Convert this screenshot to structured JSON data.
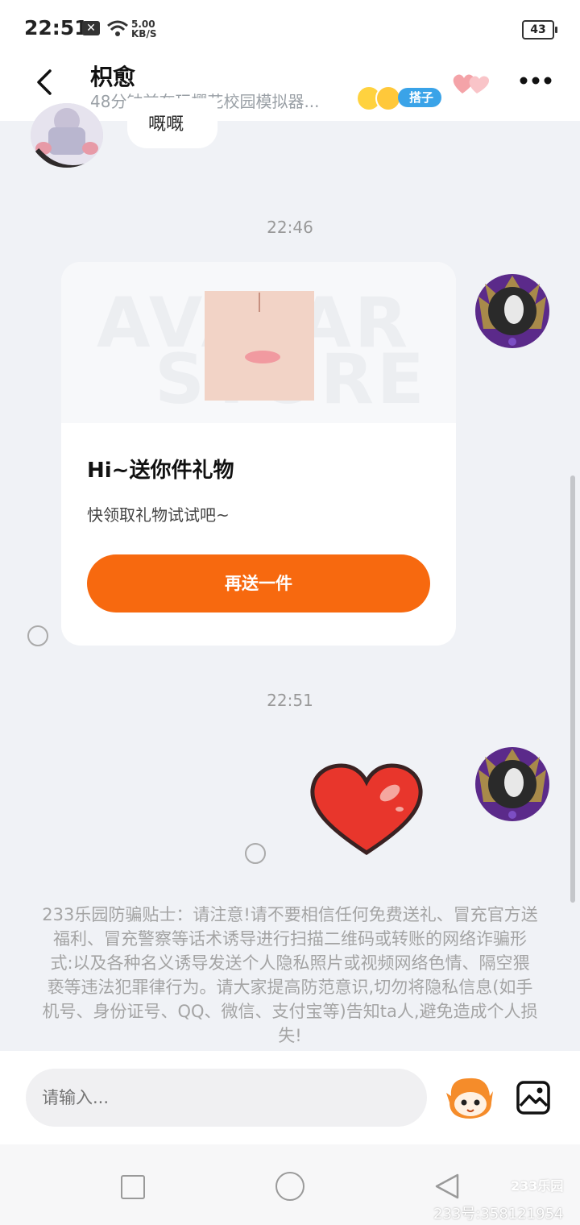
{
  "status_bar": {
    "time": "22:51",
    "notification_badge": "✕",
    "net_speed_value": "5.00",
    "net_speed_unit": "KB/S",
    "battery": "43"
  },
  "header": {
    "contact_name": "枳愈",
    "contact_status": "48分钟前在玩樱花校园模拟器...",
    "relation_badge": "搭子",
    "icons": [
      "back-arrow-icon",
      "hearts-icon",
      "more-icon"
    ]
  },
  "chat": {
    "partial_bubble_text": "嘅嘅",
    "timestamps": [
      "22:46",
      "22:51"
    ],
    "gift_card": {
      "watermark_line1": "AVATAR",
      "watermark_line2": "STORE",
      "title": "Hi~送你件礼物",
      "subtitle": "快领取礼物试试吧~",
      "button_label": "再送一件"
    }
  },
  "notice": {
    "text": "233乐园防骗贴士：请注意!请不要相信任何免费送礼、冒充官方送福利、冒充警察等话术诱导进行扫描二维码或转账的网络诈骗形式:以及各种名义诱导发送个人隐私照片或视频网络色情、隔空猥亵等违法犯罪律行为。请大家提高防范意识,切勿将隐私信息(如手机号、身份证号、QQ、微信、支付宝等)告知ta人,避免造成个人损失!"
  },
  "input_bar": {
    "placeholder": "请输入...",
    "icons": [
      "mascot-emoji-icon",
      "image-icon"
    ]
  },
  "watermark": {
    "logo": "233乐园",
    "id_text": "233号:358121954"
  },
  "colors": {
    "accent_orange": "#f7690f",
    "badge_blue": "#3aa3e8",
    "background": "#f0f2f6"
  }
}
